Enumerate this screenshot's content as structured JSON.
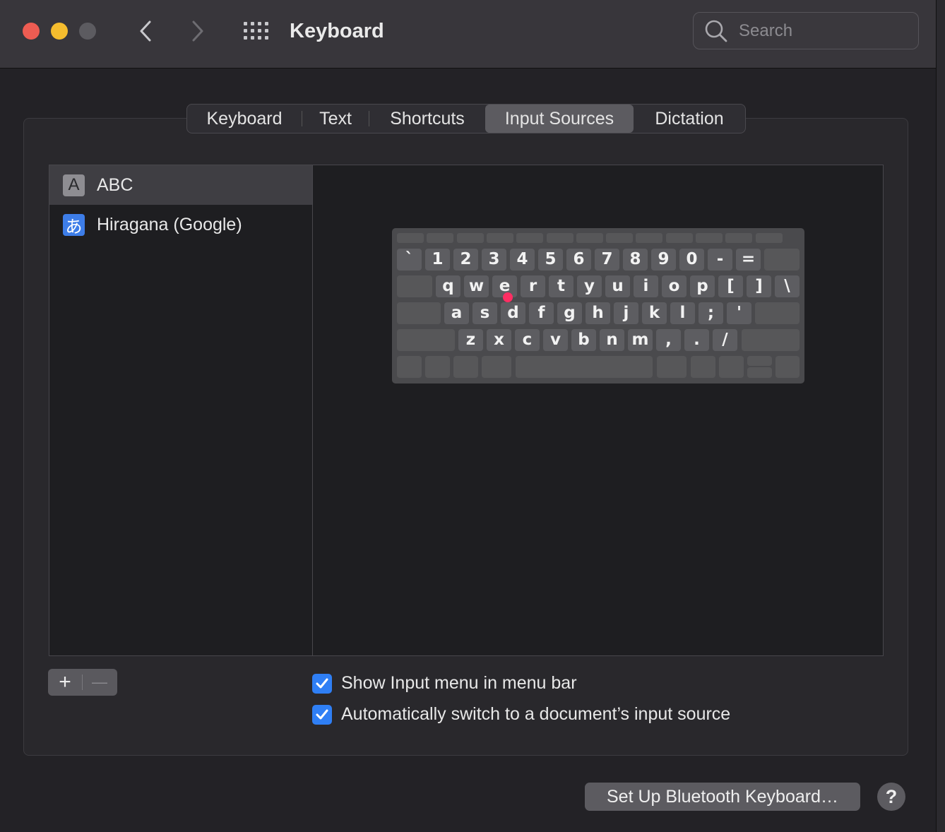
{
  "window": {
    "title": "Keyboard",
    "search_placeholder": "Search",
    "traffic_lights": {
      "close": "#ee5c52",
      "minimize": "#f5bd2e",
      "zoom": "#5c5b60"
    }
  },
  "tabs": [
    {
      "label": "Keyboard",
      "active": false
    },
    {
      "label": "Text",
      "active": false
    },
    {
      "label": "Shortcuts",
      "active": false
    },
    {
      "label": "Input Sources",
      "active": true
    },
    {
      "label": "Dictation",
      "active": false
    }
  ],
  "input_sources": [
    {
      "icon_glyph": "A",
      "label": "ABC",
      "selected": true
    },
    {
      "icon_glyph": "あ",
      "label": "Hiragana (Google)",
      "selected": false
    }
  ],
  "keyboard_rows": [
    [
      "`",
      "1",
      "2",
      "3",
      "4",
      "5",
      "6",
      "7",
      "8",
      "9",
      "0",
      "-",
      "="
    ],
    [
      "q",
      "w",
      "e",
      "r",
      "t",
      "y",
      "u",
      "i",
      "o",
      "p",
      "[",
      "]",
      "\\"
    ],
    [
      "a",
      "s",
      "d",
      "f",
      "g",
      "h",
      "j",
      "k",
      "l",
      ";",
      "'"
    ],
    [
      "z",
      "x",
      "c",
      "v",
      "b",
      "n",
      "m",
      ",",
      ".",
      "/"
    ]
  ],
  "list_controls": {
    "add": "+",
    "remove": "—"
  },
  "checkboxes": [
    {
      "label": "Show Input menu in menu bar",
      "checked": true
    },
    {
      "label": "Automatically switch to a document’s input source",
      "checked": true
    }
  ],
  "buttons": {
    "bluetooth": "Set Up Bluetooth Keyboard…",
    "help": "?"
  },
  "colors": {
    "accent": "#2f7ff5",
    "highlight_dot": "#ff2e63"
  }
}
